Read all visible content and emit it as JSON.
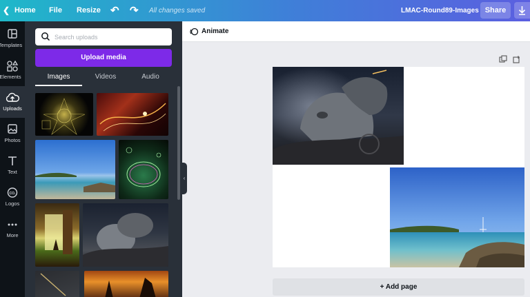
{
  "topbar": {
    "home": "Home",
    "file": "File",
    "resize": "Resize",
    "save_status": "All changes saved",
    "design_title": "LMAC-Round89-Images",
    "share": "Share"
  },
  "rail": {
    "items": [
      {
        "label": "Templates",
        "icon": "templates-icon"
      },
      {
        "label": "Elements",
        "icon": "elements-icon"
      },
      {
        "label": "Uploads",
        "icon": "cloud-upload-icon"
      },
      {
        "label": "Photos",
        "icon": "photo-icon"
      },
      {
        "label": "Text",
        "icon": "text-icon"
      },
      {
        "label": "Logos",
        "icon": "logo-icon"
      },
      {
        "label": "More",
        "icon": "more-icon"
      }
    ]
  },
  "uploads": {
    "search_placeholder": "Search uploads",
    "upload_button": "Upload media",
    "tabs": [
      "Images",
      "Videos",
      "Audio"
    ],
    "active_tab": "Images"
  },
  "canvas": {
    "animate": "Animate",
    "add_page": "+ Add page"
  },
  "colors": {
    "topbar_start": "#1fb8c9",
    "topbar_end": "#5b5fe0",
    "upload_button": "#7d2ae8",
    "panel_bg": "#293039",
    "rail_bg": "#0e1318"
  }
}
